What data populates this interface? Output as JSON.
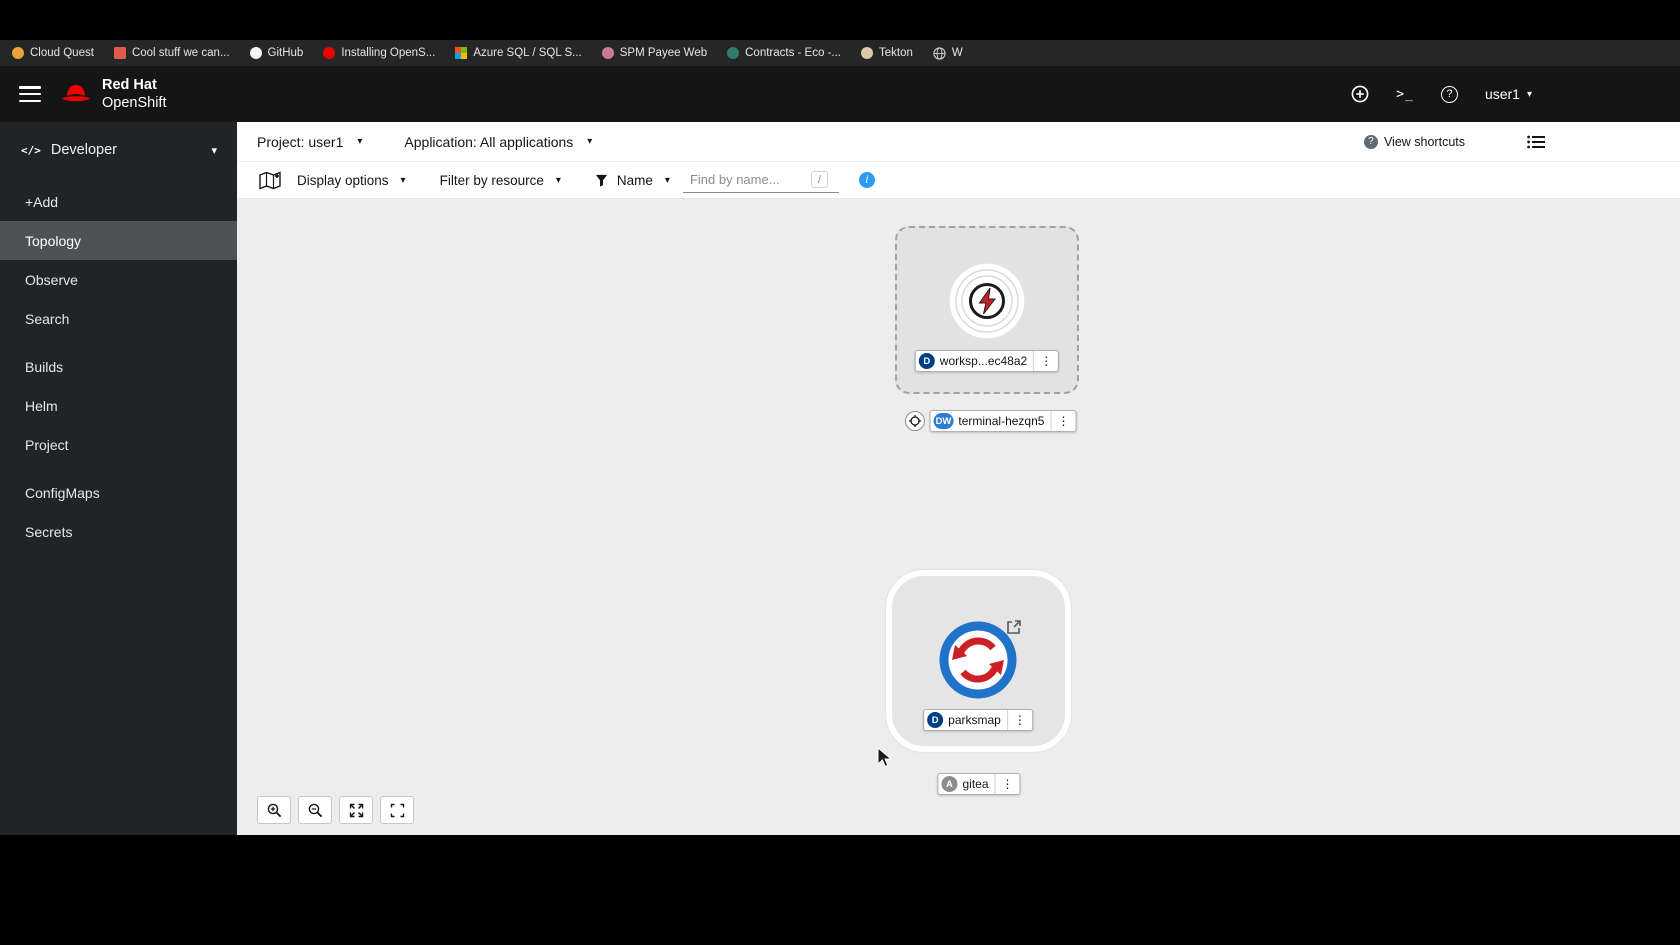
{
  "icons": {
    "caret": "▾",
    "kebab": "⋮",
    "terminal_prompt": ">_",
    "code": "</>",
    "question": "?",
    "info": "i"
  },
  "bookmarks_bar": {
    "items": [
      {
        "label": "Cloud Quest"
      },
      {
        "label": "Cool stuff we can..."
      },
      {
        "label": "GitHub"
      },
      {
        "label": "Installing OpenS..."
      },
      {
        "label": "Azure SQL / SQL S..."
      },
      {
        "label": "SPM Payee Web"
      },
      {
        "label": "Contracts - Eco -..."
      },
      {
        "label": "Tekton"
      },
      {
        "label": "W"
      }
    ]
  },
  "masthead": {
    "brand_line1": "Red Hat",
    "brand_line2": "OpenShift",
    "username": "user1"
  },
  "sidebar": {
    "perspective": "Developer",
    "groups": [
      {
        "items": [
          {
            "label": "+Add"
          },
          {
            "label": "Topology"
          },
          {
            "label": "Observe"
          },
          {
            "label": "Search"
          }
        ]
      },
      {
        "items": [
          {
            "label": "Builds"
          },
          {
            "label": "Helm"
          },
          {
            "label": "Project"
          }
        ]
      },
      {
        "items": [
          {
            "label": "ConfigMaps"
          },
          {
            "label": "Secrets"
          }
        ]
      }
    ],
    "selected_item": "Topology"
  },
  "context_bar": {
    "project": "Project: user1",
    "application": "Application: All applications",
    "view_shortcuts": "View shortcuts"
  },
  "toolbar": {
    "display_options": "Display options",
    "filter_by_resource": "Filter by resource",
    "name_filter": "Name",
    "find_placeholder": "Find by name...",
    "shortcut_key": "/"
  },
  "topology": {
    "workspace_node": {
      "badge": "D",
      "label": "worksp...ec48a2"
    },
    "terminal_node": {
      "badge": "DW",
      "label": "terminal-hezqn5"
    },
    "parksmap_node": {
      "badge": "D",
      "label": "parksmap"
    },
    "gitea_group": {
      "badge": "A",
      "label": "gitea"
    }
  },
  "colors": {
    "masthead_bg": "#151515",
    "sidebar_bg": "#212427",
    "selected_nav_bg": "#4f5255",
    "canvas_bg": "#ededed",
    "deployment_badge": "#004080",
    "devworkspace_badge": "#2e7dd1",
    "application_badge": "#8a8d90",
    "info_icon": "#2b9af3",
    "redhat_red": "#ee0000"
  }
}
